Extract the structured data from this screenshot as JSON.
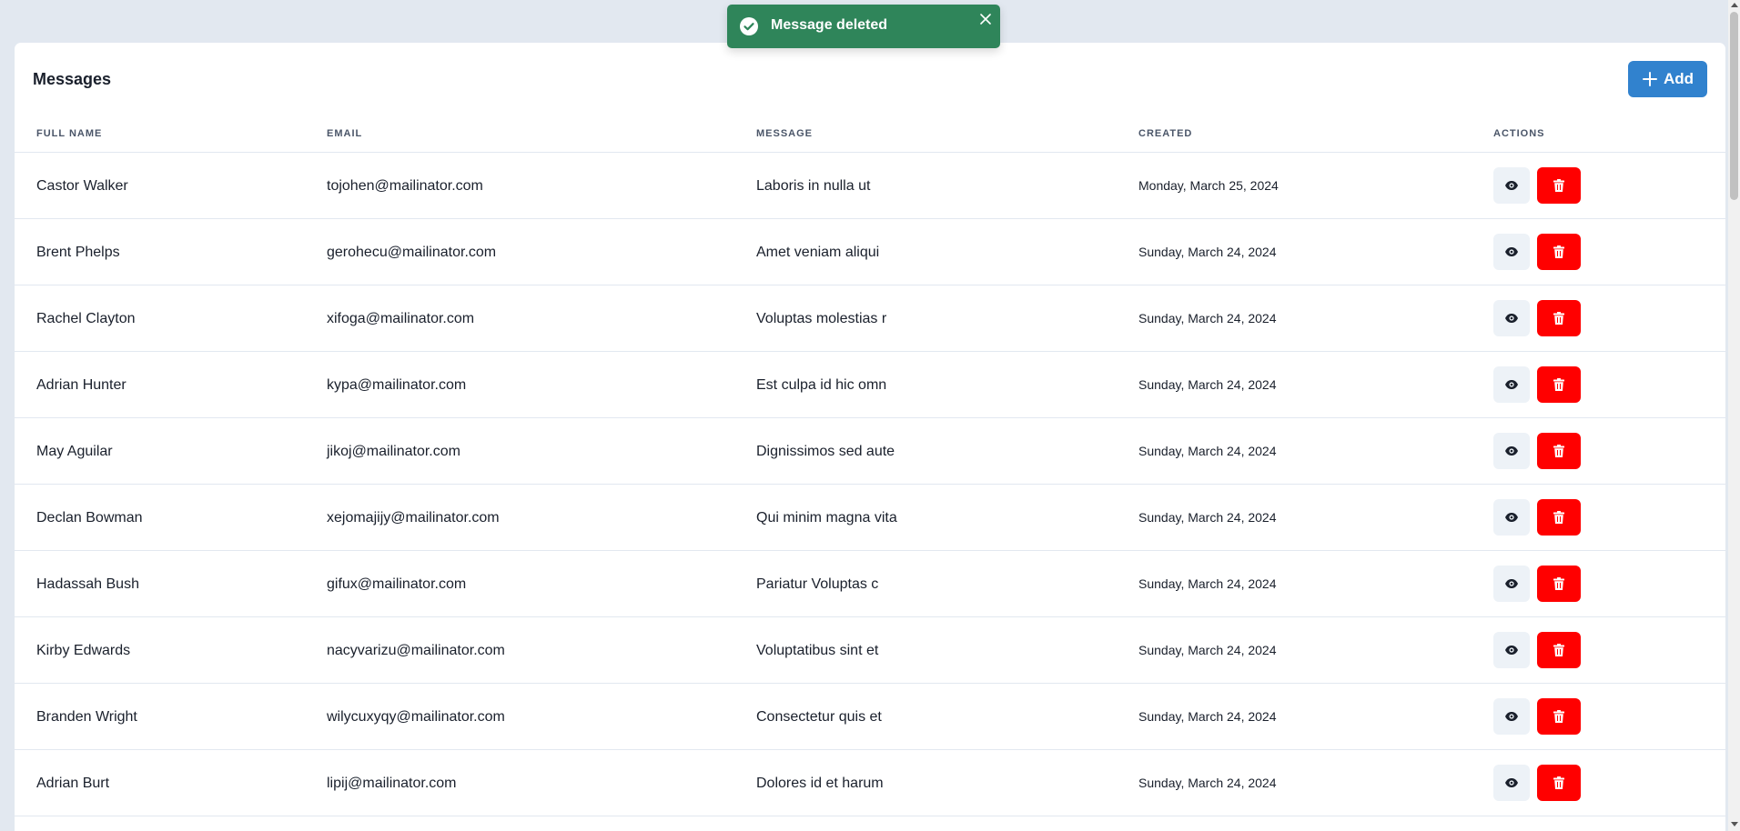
{
  "card": {
    "title": "Messages",
    "add_label": "Add"
  },
  "table": {
    "headers": {
      "full_name": "FULL NAME",
      "email": "EMAIL",
      "message": "MESSAGE",
      "created": "CREATED",
      "actions": "ACTIONS"
    },
    "rows": [
      {
        "name": "Castor Walker",
        "email": "tojohen@mailinator.com",
        "message": "Laboris in nulla ut",
        "created": "Monday, March 25, 2024"
      },
      {
        "name": "Brent Phelps",
        "email": "gerohecu@mailinator.com",
        "message": "Amet veniam aliqui",
        "created": "Sunday, March 24, 2024"
      },
      {
        "name": "Rachel Clayton",
        "email": "xifoga@mailinator.com",
        "message": "Voluptas molestias r",
        "created": "Sunday, March 24, 2024"
      },
      {
        "name": "Adrian Hunter",
        "email": "kypa@mailinator.com",
        "message": "Est culpa id hic omn",
        "created": "Sunday, March 24, 2024"
      },
      {
        "name": "May Aguilar",
        "email": "jikoj@mailinator.com",
        "message": "Dignissimos sed aute",
        "created": "Sunday, March 24, 2024"
      },
      {
        "name": "Declan Bowman",
        "email": "xejomajijy@mailinator.com",
        "message": "Qui minim magna vita",
        "created": "Sunday, March 24, 2024"
      },
      {
        "name": "Hadassah Bush",
        "email": "gifux@mailinator.com",
        "message": "Pariatur Voluptas c",
        "created": "Sunday, March 24, 2024"
      },
      {
        "name": "Kirby Edwards",
        "email": "nacyvarizu@mailinator.com",
        "message": "Voluptatibus sint et",
        "created": "Sunday, March 24, 2024"
      },
      {
        "name": "Branden Wright",
        "email": "wilycuxyqy@mailinator.com",
        "message": "Consectetur quis et",
        "created": "Sunday, March 24, 2024"
      },
      {
        "name": "Adrian Burt",
        "email": "lipij@mailinator.com",
        "message": "Dolores id et harum",
        "created": "Sunday, March 24, 2024"
      }
    ],
    "row_actions": {
      "view_icon": "eye-icon",
      "delete_icon": "trash-icon"
    }
  },
  "toast": {
    "text": "Message deleted",
    "icon": "check-circle-icon",
    "status": "success"
  },
  "colors": {
    "background": "#e2e8f0",
    "primary": "#3182ce",
    "danger": "#ff0000",
    "success": "#2f855a"
  }
}
